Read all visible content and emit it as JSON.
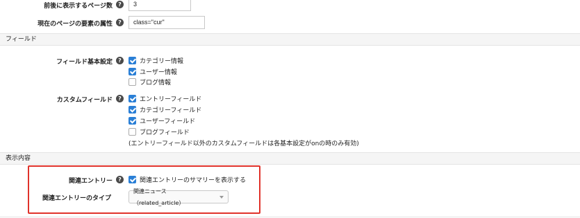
{
  "pagination": {
    "neighbor_pages_label": "前後に表示するページ数",
    "neighbor_pages_value": "3",
    "current_attr_label": "現在のページの要素の属性",
    "current_attr_value": "class=\"cur\""
  },
  "fields_section": {
    "title": "フィールド",
    "basic_label": "フィールド基本設定",
    "basic_options": [
      {
        "label": "カテゴリー情報",
        "checked": true
      },
      {
        "label": "ユーザー情報",
        "checked": true
      },
      {
        "label": "ブログ情報",
        "checked": false
      }
    ],
    "custom_label": "カスタムフィールド",
    "custom_options": [
      {
        "label": "エントリーフィールド",
        "checked": true
      },
      {
        "label": "カテゴリーフィールド",
        "checked": true
      },
      {
        "label": "ユーザーフィールド",
        "checked": true
      },
      {
        "label": "ブログフィールド",
        "checked": false
      }
    ],
    "custom_note": "(エントリーフィールド以外のカスタムフィールドは各基本設定がonの時のみ有効)"
  },
  "display_section": {
    "title": "表示内容",
    "related_label": "関連エントリー",
    "related_option": {
      "label": "関連エントリーのサマリーを表示する",
      "checked": true
    },
    "related_type_label": "関連エントリーのタイプ",
    "related_type_value": "関連ニュース（related_article）"
  },
  "help_glyph": "?",
  "colors": {
    "accent": "#2a7fd6",
    "highlight": "#e0322a",
    "section_bg": "#f5f5f5"
  }
}
